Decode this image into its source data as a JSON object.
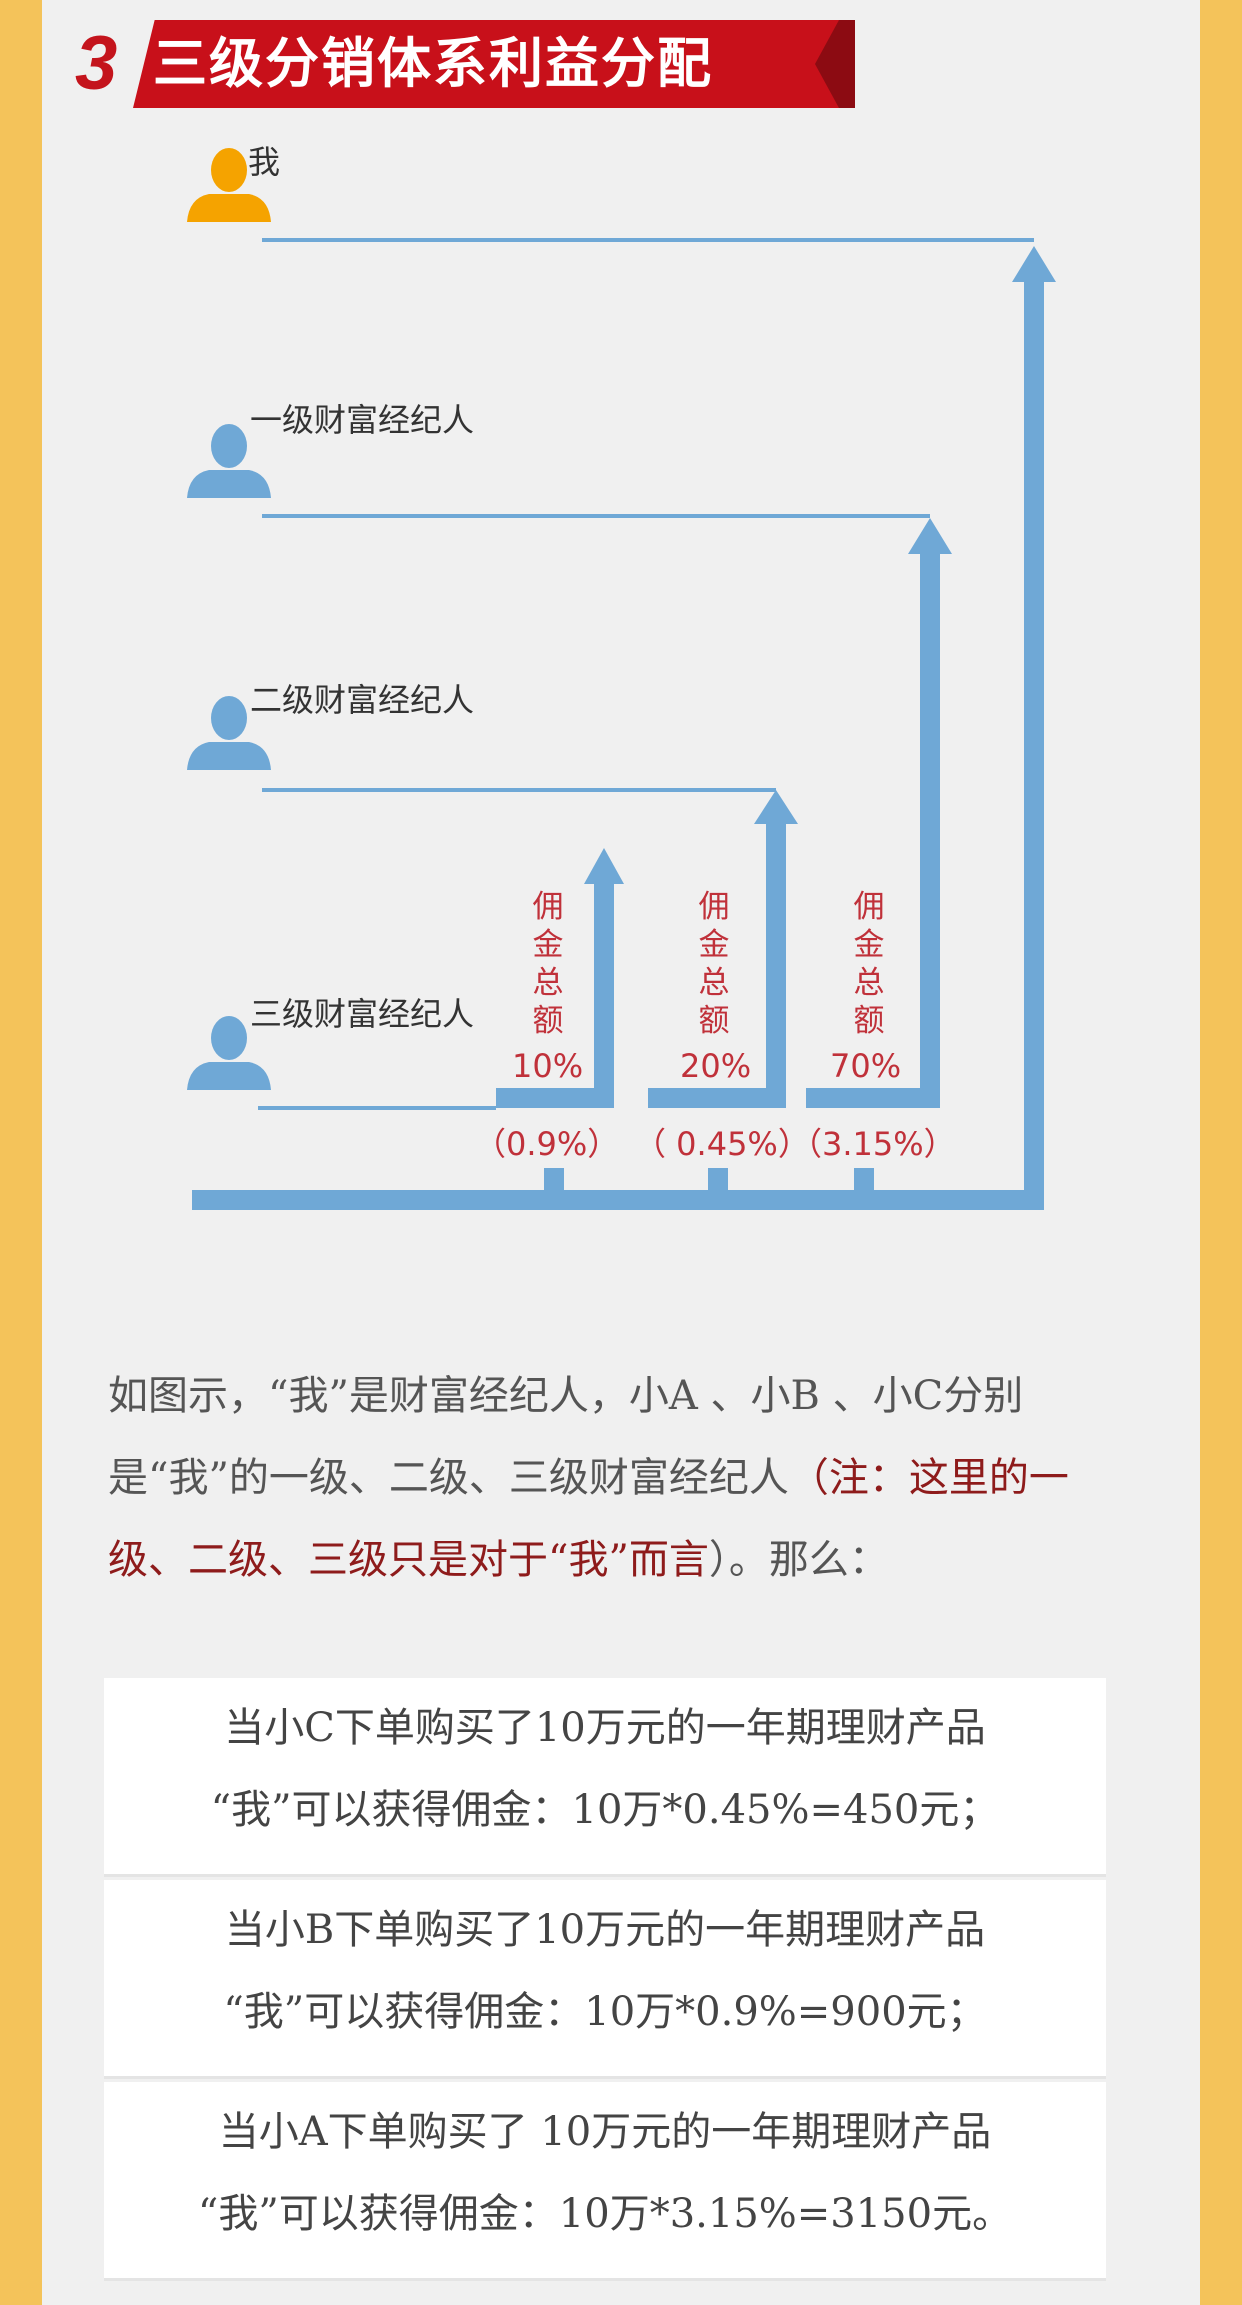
{
  "title": {
    "number": "3",
    "text": "三级分销体系利益分配"
  },
  "roles": {
    "me": "我",
    "level1": "一级财富经纪人",
    "level2": "二级财富经纪人",
    "level3": "三级财富经纪人"
  },
  "commission": {
    "vertical_label": "佣金总额",
    "arrow1_pct": "10%",
    "arrow2_pct": "20%",
    "arrow3_pct": "70%",
    "paren1": "（0.9%）",
    "paren2": "（ 0.45%）",
    "paren3": "（3.15%）"
  },
  "paragraph": {
    "part1": "如图示，“我”是财富经纪人，小A 、小B 、小C分别是“我”的一级、二级、三级财富经纪人",
    "red": "（注：这里的一级、二级、三级只是对于“我”而言",
    "part2": "）。那么："
  },
  "boxes": [
    {
      "line1": "当小C下单购买了10万元的一年期理财产品",
      "line2": "“我”可以获得佣金：10万*0.45%=450元；"
    },
    {
      "line1": "当小B下单购买了10万元的一年期理财产品",
      "line2": "“我”可以获得佣金：10万*0.9%=900元；"
    },
    {
      "line1": "当小A下单购买了 10万元的一年期理财产品",
      "line2": "“我”可以获得佣金：10万*3.15%=3150元。"
    }
  ],
  "colors": {
    "accent_red": "#c8101a",
    "arrow_blue": "#6fa8d6",
    "me_orange": "#f5a300",
    "person_blue": "#6fa8d6"
  }
}
